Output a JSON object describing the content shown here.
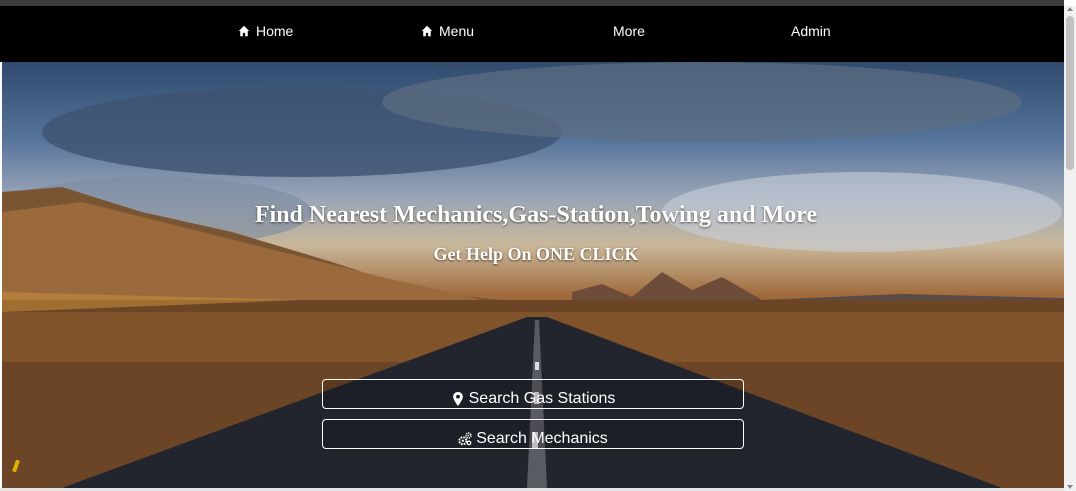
{
  "nav": {
    "items": [
      {
        "label": "Home",
        "icon": "home-icon"
      },
      {
        "label": "Menu",
        "icon": "home-icon"
      },
      {
        "label": "More"
      },
      {
        "label": "Admin"
      }
    ]
  },
  "hero": {
    "headline": "Find Nearest Mechanics,Gas-Station,Towing and More",
    "subline": "Get Help On ONE CLICK",
    "buttons": [
      {
        "label": "Search Gas Stations",
        "icon": "map-marker-icon"
      },
      {
        "label": "Search Mechanics",
        "icon": "gears-icon"
      }
    ]
  },
  "colors": {
    "navbar": "#000000",
    "text": "#ffffff"
  }
}
